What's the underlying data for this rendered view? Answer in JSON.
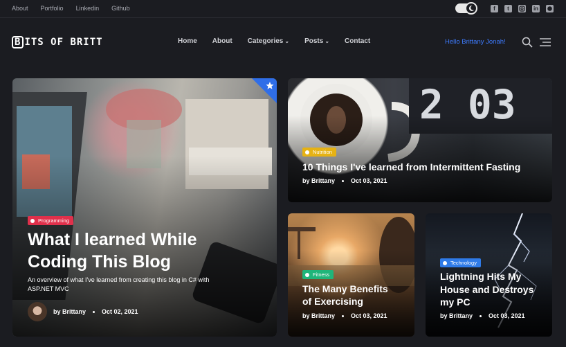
{
  "topbar": {
    "links": [
      "About",
      "Portfolio",
      "Linkedin",
      "Github"
    ],
    "theme_toggle_icon": "moon-icon",
    "social_icons": [
      "facebook-icon",
      "twitter-icon",
      "instagram-icon",
      "linkedin-icon",
      "github-icon"
    ]
  },
  "header": {
    "logo_text": "ITS OF BRITT",
    "logo_letter": "B",
    "nav": [
      {
        "label": "Home"
      },
      {
        "label": "About"
      },
      {
        "label": "Categories",
        "dropdown": true
      },
      {
        "label": "Posts",
        "dropdown": true
      },
      {
        "label": "Contact"
      }
    ],
    "greeting": "Hello Brittany Jonah!",
    "greeting_color": "#3d7bff"
  },
  "featured": {
    "category": "Programming",
    "category_color": "#e0304b",
    "title_line1": "What I learned While",
    "title_line2": "Coding This Blog",
    "description_line1": "An overview of what I've learned from creating this blog in C# with",
    "description_line2": "ASP.NET MVC",
    "author": "by Brittany",
    "date": "Oct 02, 2021",
    "pin_icon": "star-icon",
    "pin_color": "#2f6ee8"
  },
  "posts": [
    {
      "category": "Nutrition",
      "category_color": "#e6b213",
      "title": "10 Things I've learned from Intermittent Fasting",
      "author": "by Brittany",
      "date": "Oct 03, 2021"
    },
    {
      "category": "Fitness",
      "category_color": "#1fb57a",
      "title_line1": "The Many Benefits",
      "title_line2": "of Exercising",
      "author": "by Brittany",
      "date": "Oct 03, 2021"
    },
    {
      "category": "Technology",
      "category_color": "#2f7be8",
      "title_line1": "Lightning Hits My",
      "title_line2": "House and Destroys",
      "title_line3": "my PC",
      "author": "by Brittany",
      "date": "Oct 03, 2021"
    }
  ]
}
